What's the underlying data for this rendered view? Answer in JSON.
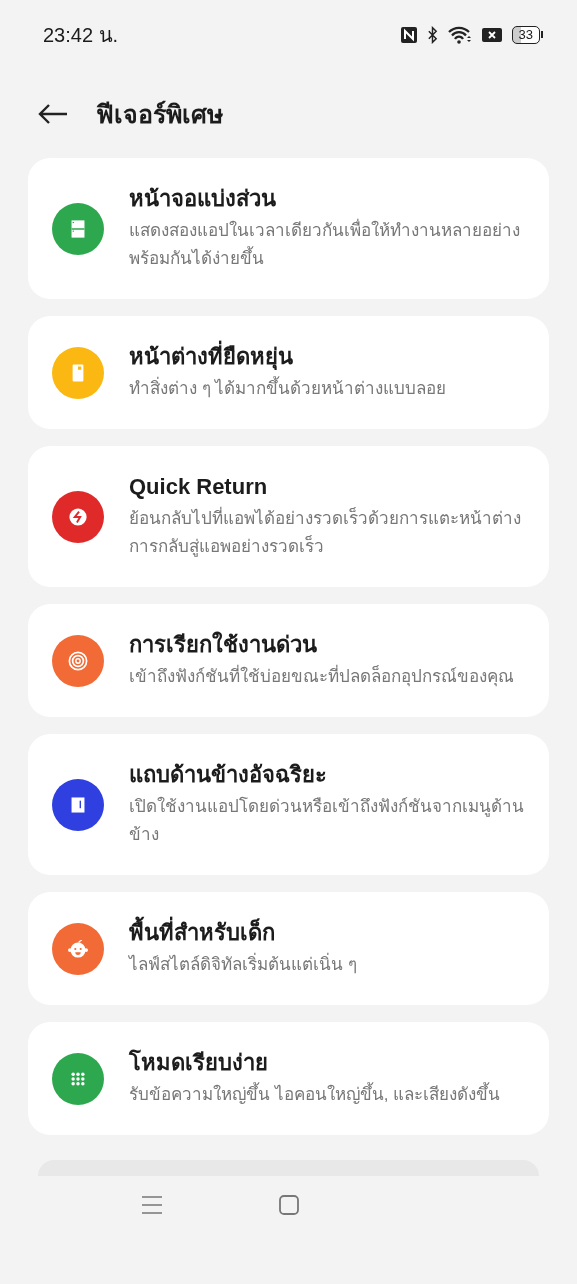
{
  "status_bar": {
    "time": "23:42 น.",
    "battery": "33"
  },
  "header": {
    "title": "ฟีเจอร์พิเศษ"
  },
  "features": [
    {
      "title": "หน้าจอแบ่งส่วน",
      "description": "แสดงสองแอปในเวลาเดียวกันเพื่อให้ทำงานหลายอย่างพร้อมกันได้ง่ายขึ้น",
      "color": "#2ea84f"
    },
    {
      "title": "หน้าต่างที่ยืดหยุ่น",
      "description": "ทำสิ่งต่าง ๆ ได้มากขึ้นด้วยหน้าต่างแบบลอย",
      "color": "#fbb812"
    },
    {
      "title": "Quick Return",
      "description": "ย้อนกลับไปที่แอพได้อย่างรวดเร็วด้วยการแตะหน้าต่างการกลับสู่แอพอย่างรวดเร็ว",
      "color": "#e02a2a"
    },
    {
      "title": "การเรียกใช้งานด่วน",
      "description": "เข้าถึงฟังก์ชันที่ใช้บ่อยขณะที่ปลดล็อกอุปกรณ์ของคุณ",
      "color": "#f26a35"
    },
    {
      "title": "แถบด้านข้างอัจฉริยะ",
      "description": "เปิดใช้งานแอปโดยด่วนหรือเข้าถึงฟังก์ชันจากเมนูด้านข้าง",
      "color": "#2f3fe0"
    },
    {
      "title": "พื้นที่สำหรับเด็ก",
      "description": "ไลฟ์สไตล์ดิจิทัลเริ่มต้นแต่เนิ่น ๆ",
      "color": "#f26a35"
    },
    {
      "title": "โหมดเรียบง่าย",
      "description": "รับข้อความใหญ่ขึ้น ไอคอนใหญ่ขึ้น, และเสียงดังขึ้น",
      "color": "#2ea84f"
    }
  ]
}
